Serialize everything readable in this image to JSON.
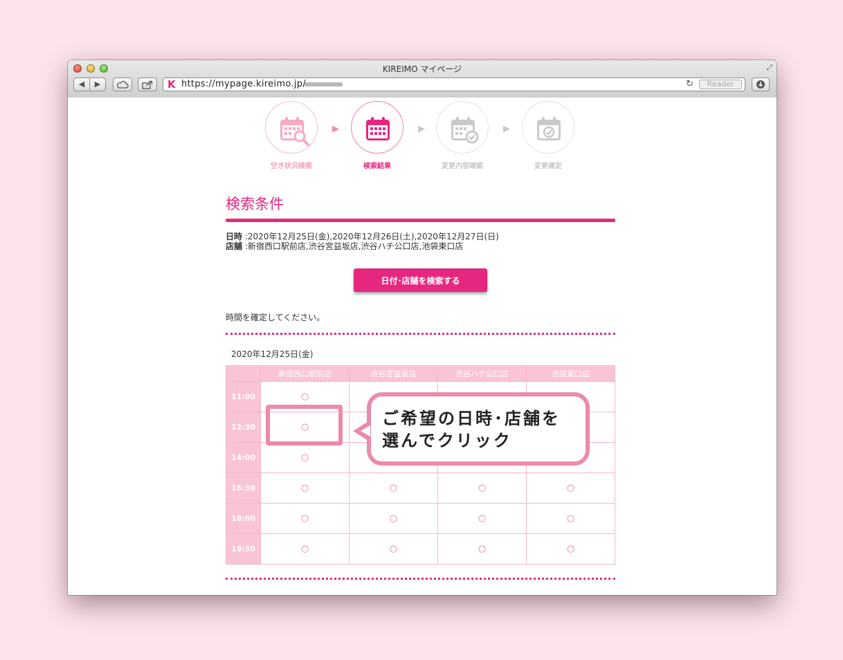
{
  "browser": {
    "title": "KIREIMO マイページ",
    "url": "https://mypage.kireimo.jp/",
    "favicon": "K",
    "reader_label": "Reader",
    "back_icon": "◀",
    "forward_icon": "▶",
    "reload_icon": "↻",
    "resize_icon": "⤢"
  },
  "steps": [
    {
      "label": "空き状況検索",
      "icon": "calendar-search-icon"
    },
    {
      "label": "検索結果",
      "icon": "calendar-icon"
    },
    {
      "label": "変更内容確認",
      "icon": "calendar-check-icon"
    },
    {
      "label": "変更確定",
      "icon": "calendar-confirm-icon"
    }
  ],
  "section_title": "検索条件",
  "conditions": {
    "date_label": "日時",
    "date_value": ":2020年12月25日(金),2020年12月26日(土),2020年12月27日(日)",
    "store_label": "店舗",
    "store_value": ":新宿西口駅前店,渋谷宮益坂店,渋谷ハチ公口店,池袋東口店"
  },
  "search_button": "日付･店舗を検索する",
  "instruction": "時間を確定してください。",
  "day": {
    "label": "2020年12月25日(金)",
    "stores": [
      "新宿西口駅前店",
      "渋谷宮益坂店",
      "渋谷ハチ公口店",
      "池袋東口店"
    ],
    "rows": [
      {
        "time": "11:00",
        "slots": [
          "○",
          "",
          "",
          ""
        ]
      },
      {
        "time": "12:30",
        "slots": [
          "○",
          "",
          "",
          ""
        ]
      },
      {
        "time": "14:00",
        "slots": [
          "○",
          "",
          "",
          ""
        ]
      },
      {
        "time": "16:30",
        "slots": [
          "○",
          "○",
          "○",
          "○"
        ]
      },
      {
        "time": "18:00",
        "slots": [
          "○",
          "○",
          "○",
          "○"
        ]
      },
      {
        "time": "19:30",
        "slots": [
          "○",
          "○",
          "○",
          "○"
        ]
      }
    ]
  },
  "callout": {
    "line1": "ご希望の日時･店舗を",
    "line2": "選んでクリック"
  },
  "colors": {
    "brand": "#e6277f",
    "table_header": "#f9c4d4",
    "callout_border": "#ec8aaa",
    "background": "#fde4ec"
  }
}
